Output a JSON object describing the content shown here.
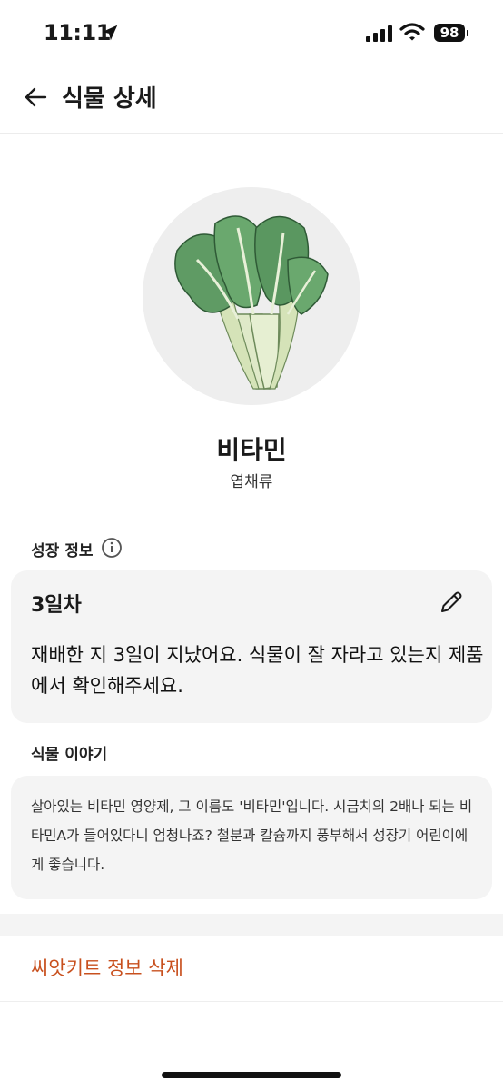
{
  "status_bar": {
    "time": "11:11",
    "battery": "98"
  },
  "header": {
    "title": "식물 상세"
  },
  "plant": {
    "name": "비타민",
    "category": "엽채류"
  },
  "growth": {
    "section_label": "성장 정보",
    "days": "3일차",
    "message": "재배한 지 3일이 지났어요. 식물이 잘 자라고 있는지 제품에서 확인해주세요."
  },
  "story": {
    "section_label": "식물 이야기",
    "text": "살아있는 비타민 영양제, 그 이름도 '비타민'입니다. 시금치의 2배나 되는 비타민A가 들어있다니 엄청나죠? 철분과 칼슘까지 풍부해서 성장기 어린이에게 좋습니다."
  },
  "actions": {
    "delete_label": "씨앗키트 정보 삭제"
  },
  "colors": {
    "accent": "#c8501e",
    "card_bg": "#f4f4f4"
  }
}
